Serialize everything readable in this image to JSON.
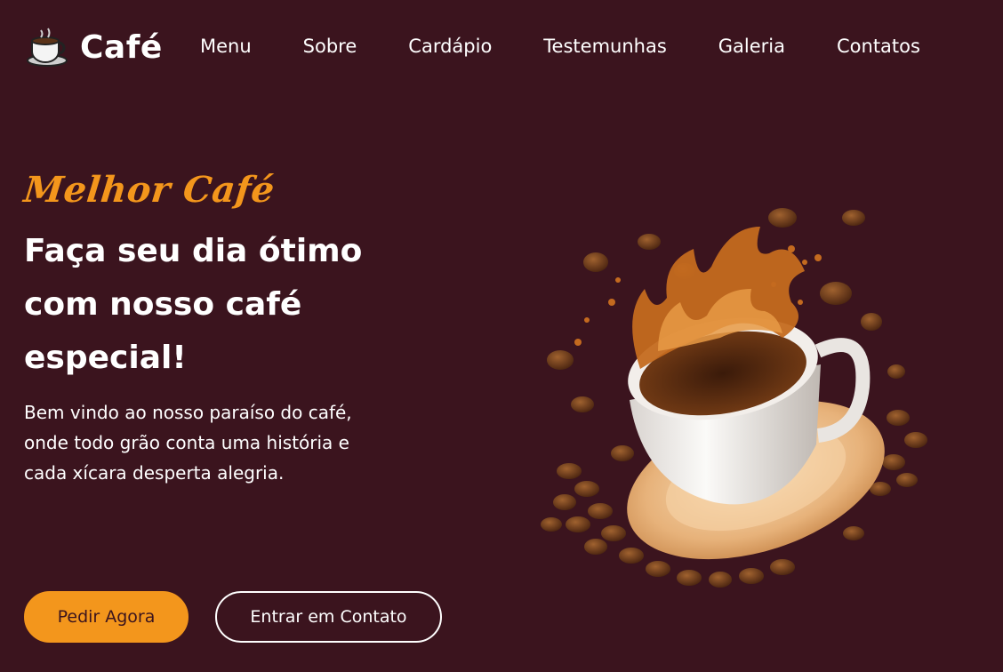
{
  "brand": {
    "name": "Café",
    "logo_icon": "coffee-cup-icon"
  },
  "nav": {
    "links": [
      {
        "label": "Menu"
      },
      {
        "label": "Sobre"
      },
      {
        "label": "Cardápio"
      },
      {
        "label": "Testemunhas"
      },
      {
        "label": "Galeria"
      },
      {
        "label": "Contatos"
      }
    ]
  },
  "hero": {
    "subtitle": "Melhor Café",
    "title": "Faça seu dia ótimo com nosso café especial!",
    "description": "Bem vindo ao nosso paraíso do café, onde todo grão conta uma história e cada xícara desperta alegria.",
    "primary_button": "Pedir Agora",
    "secondary_button": "Entrar em Contato"
  },
  "colors": {
    "background": "#3b141e",
    "accent": "#f3961c",
    "text": "#ffffff"
  }
}
